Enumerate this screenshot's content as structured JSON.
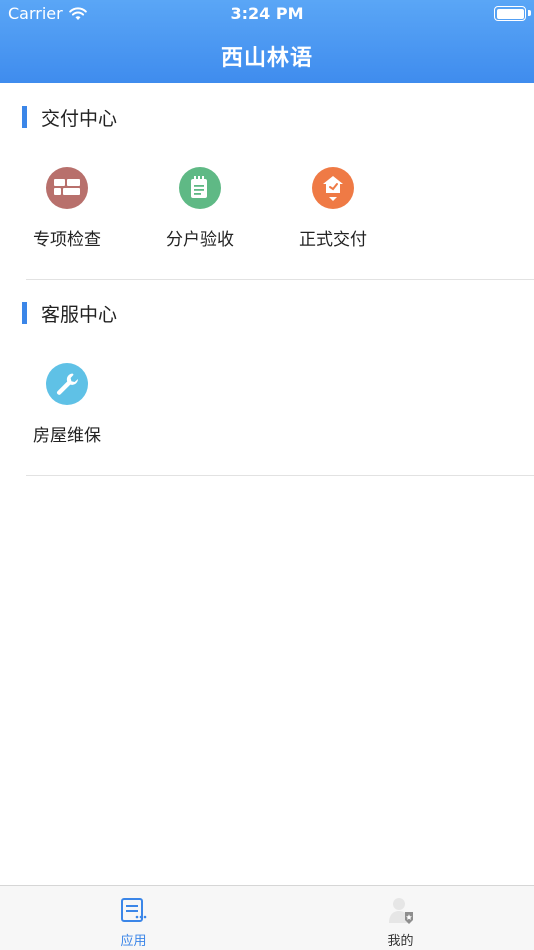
{
  "status_bar": {
    "carrier": "Carrier",
    "time": "3:24 PM",
    "wifi_icon": "wifi-icon",
    "battery_icon": "battery-icon"
  },
  "nav": {
    "title": "西山林语"
  },
  "sections": [
    {
      "title": "交付中心",
      "items": [
        {
          "label": "专项检查",
          "icon": "grid-blocks-icon",
          "color": "#b8706c"
        },
        {
          "label": "分户验收",
          "icon": "notepad-icon",
          "color": "#5fb985"
        },
        {
          "label": "正式交付",
          "icon": "house-pin-icon",
          "color": "#ef7a45"
        }
      ]
    },
    {
      "title": "客服中心",
      "items": [
        {
          "label": "房屋维保",
          "icon": "wrench-icon",
          "color": "#5fc1e6"
        }
      ]
    }
  ],
  "tabbar": {
    "tabs": [
      {
        "label": "应用",
        "icon": "apps-list-icon",
        "active": true,
        "color": "#3b86e8"
      },
      {
        "label": "我的",
        "icon": "profile-icon",
        "active": false,
        "color": "#333333"
      }
    ]
  }
}
